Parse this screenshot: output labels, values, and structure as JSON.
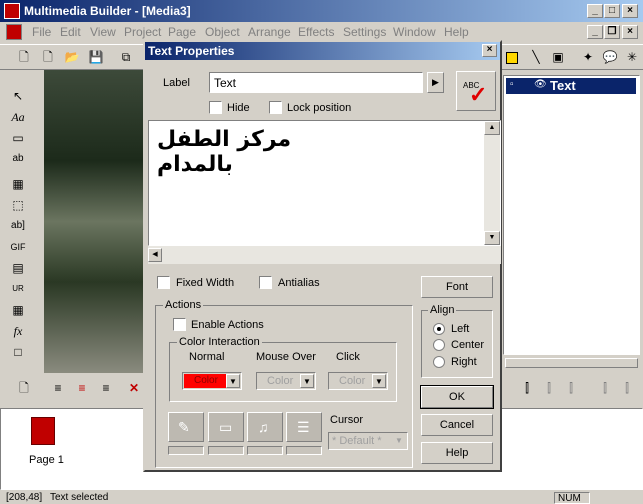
{
  "app": {
    "title": "Multimedia Builder - [Media3]"
  },
  "menu": [
    "File",
    "Edit",
    "View",
    "Project",
    "Page",
    "Object",
    "Arrange",
    "Effects",
    "Settings",
    "Window",
    "Help"
  ],
  "objects_panel": {
    "item": "Text"
  },
  "pages": {
    "page1": "Page 1"
  },
  "status": {
    "coords": "[208,48]",
    "text": "Text selected",
    "num": "NUM"
  },
  "dialog": {
    "title": "Text Properties",
    "label_caption": "Label",
    "label_value": "Text",
    "hide": "Hide",
    "lock_position": "Lock position",
    "text_content": "مركز الطفل بالمدام",
    "fixed_width": "Fixed Width",
    "antialias": "Antialias",
    "font_button": "Font",
    "actions_group": "Actions",
    "enable_actions": "Enable Actions",
    "color_interaction": "Color Interaction",
    "normal": "Normal",
    "mouse_over": "Mouse Over",
    "click": "Click",
    "color_normal": "Color",
    "color_mouse_over": "Color",
    "color_click": "Color",
    "cursor_label": "Cursor",
    "cursor_value": "* Default *",
    "align_group": "Align",
    "align_left": "Left",
    "align_center": "Center",
    "align_right": "Right",
    "ok": "OK",
    "cancel": "Cancel",
    "help": "Help",
    "spell_badge": "ABC"
  },
  "colors": {
    "normal_swatch": "#ff0000",
    "titlebar": "#0a246a"
  }
}
